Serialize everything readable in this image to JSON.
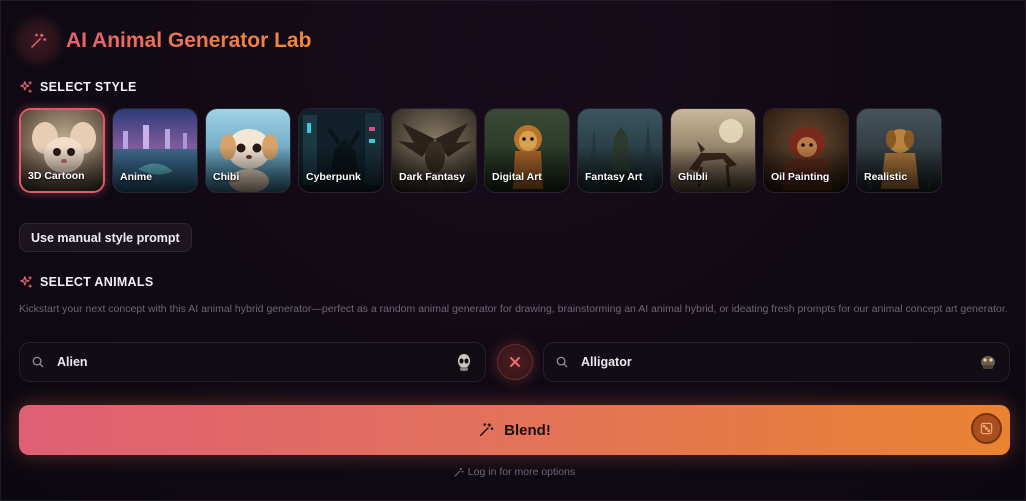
{
  "app": {
    "title": "AI Animal Generator Lab",
    "accent_start": "#e8616e",
    "accent_end": "#ef8a3c",
    "logo_icon": "magic-wand-icon"
  },
  "style_section": {
    "label": "SELECT STYLE",
    "icon": "sparkles-icon",
    "selected": "3D Cartoon",
    "styles": [
      {
        "label": "3D Cartoon",
        "selected": true
      },
      {
        "label": "Anime",
        "selected": false
      },
      {
        "label": "Chibi",
        "selected": false
      },
      {
        "label": "Cyberpunk",
        "selected": false
      },
      {
        "label": "Dark Fantasy",
        "selected": false
      },
      {
        "label": "Digital Art",
        "selected": false
      },
      {
        "label": "Fantasy Art",
        "selected": false
      },
      {
        "label": "Ghibli",
        "selected": false
      },
      {
        "label": "Oil Painting",
        "selected": false
      },
      {
        "label": "Realistic",
        "selected": false
      }
    ],
    "manual_button": "Use manual style prompt"
  },
  "animal_section": {
    "label": "SELECT ANIMALS",
    "icon": "sparkles-icon",
    "description": "Kickstart your next concept with this AI animal hybrid generator—perfect as a random animal generator for drawing, brainstorming an AI animal hybrid, or ideating fresh prompts for our animal concept art generator.",
    "animal_1": {
      "value": "Alien",
      "icon": "alien-avatar-icon"
    },
    "animal_2": {
      "value": "Alligator",
      "icon": "alligator-avatar-icon"
    },
    "clear_icon": "close-icon"
  },
  "actions": {
    "blend_label": "Blend!",
    "blend_icon": "magic-wand-icon",
    "random_icon": "dice-icon",
    "login_hint": "Log in for more options"
  }
}
